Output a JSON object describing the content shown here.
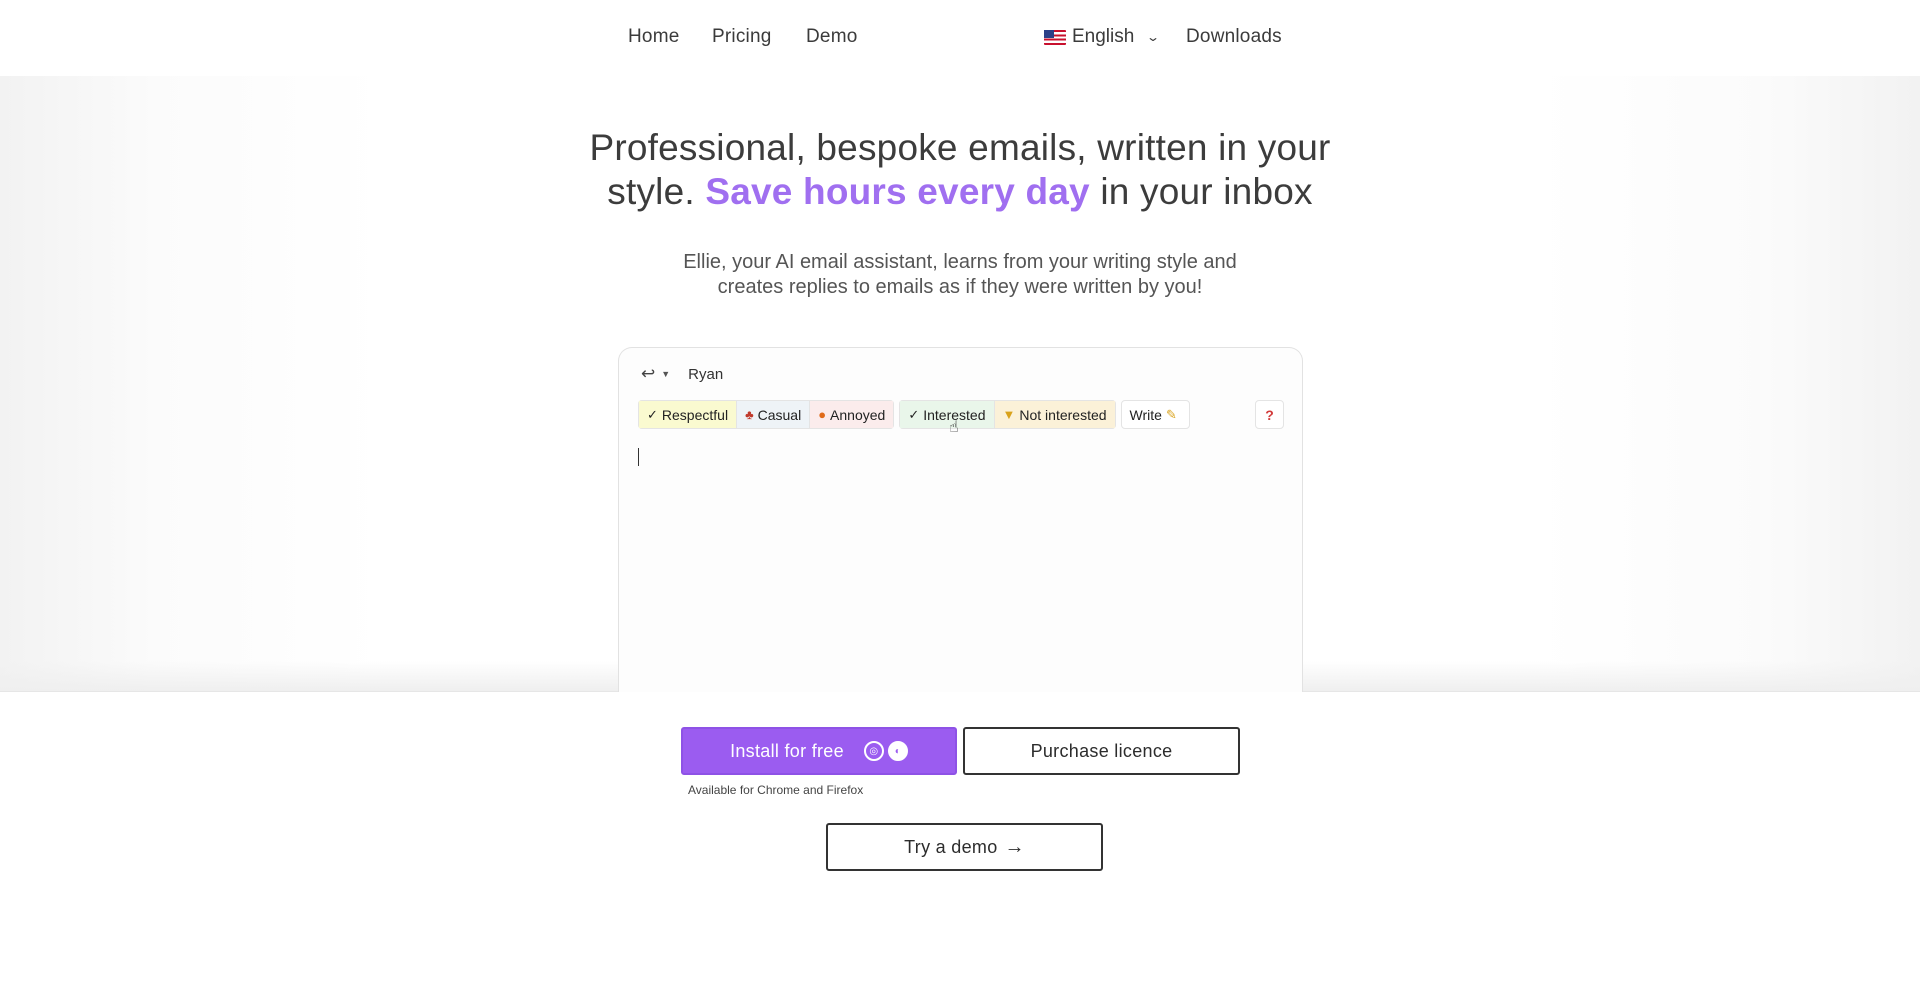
{
  "nav": {
    "home": "Home",
    "pricing": "Pricing",
    "demo": "Demo",
    "language": "English",
    "downloads": "Downloads"
  },
  "hero": {
    "headline_line1": "Professional, bespoke emails, written in your",
    "headline_line2_pre": "style.",
    "headline_highlight": "Save hours every day",
    "headline_line2_post": "in your inbox",
    "subtitle_line1": "Ellie, your AI email assistant, learns from your writing style and",
    "subtitle_line2": "creates replies to emails as if they were written by you!"
  },
  "email_card": {
    "recipient": "Ryan",
    "chips": {
      "respectful": "Respectful",
      "casual": "Casual",
      "annoyed": "Annoyed",
      "interested": "Interested",
      "not_interested": "Not interested",
      "write": "Write"
    },
    "help": "?"
  },
  "cta": {
    "install": "Install for free",
    "purchase": "Purchase licence",
    "availability": "Available for Chrome and Firefox",
    "demo": "Try a demo"
  },
  "colors": {
    "accent": "#9b5cf0",
    "highlight": "#a06ff0"
  }
}
